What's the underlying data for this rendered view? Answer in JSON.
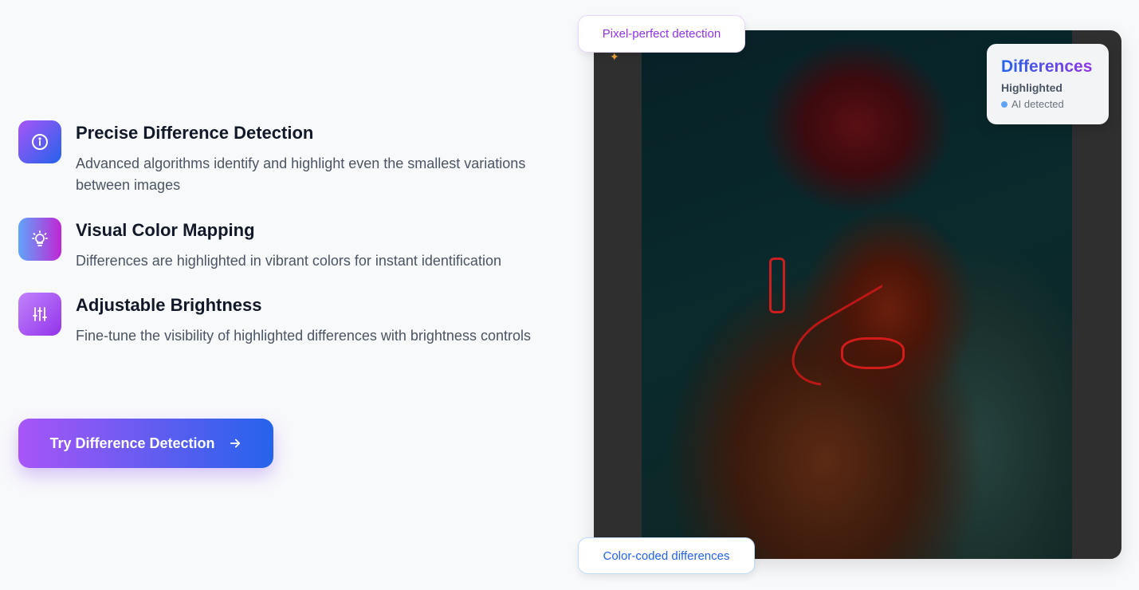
{
  "features": [
    {
      "icon": "info-icon",
      "title": "Precise Difference Detection",
      "description": "Advanced algorithms identify and highlight even the smallest variations between images"
    },
    {
      "icon": "lightbulb-icon",
      "title": "Visual Color Mapping",
      "description": "Differences are highlighted in vibrant colors for instant identification"
    },
    {
      "icon": "sliders-icon",
      "title": "Adjustable Brightness",
      "description": "Fine-tune the visibility of highlighted differences with brightness controls"
    }
  ],
  "cta": {
    "label": "Try Difference Detection",
    "icon": "arrow-right-icon"
  },
  "preview": {
    "badge_top": "Pixel-perfect detection",
    "badge_bottom": "Color-coded differences",
    "card": {
      "title": "Differences",
      "subtitle": "Highlighted",
      "status": "AI detected"
    }
  },
  "colors": {
    "accent_purple": "#a855f7",
    "accent_blue": "#2563eb",
    "highlight_red": "#e11d1d",
    "status_dot": "#60a5fa"
  }
}
